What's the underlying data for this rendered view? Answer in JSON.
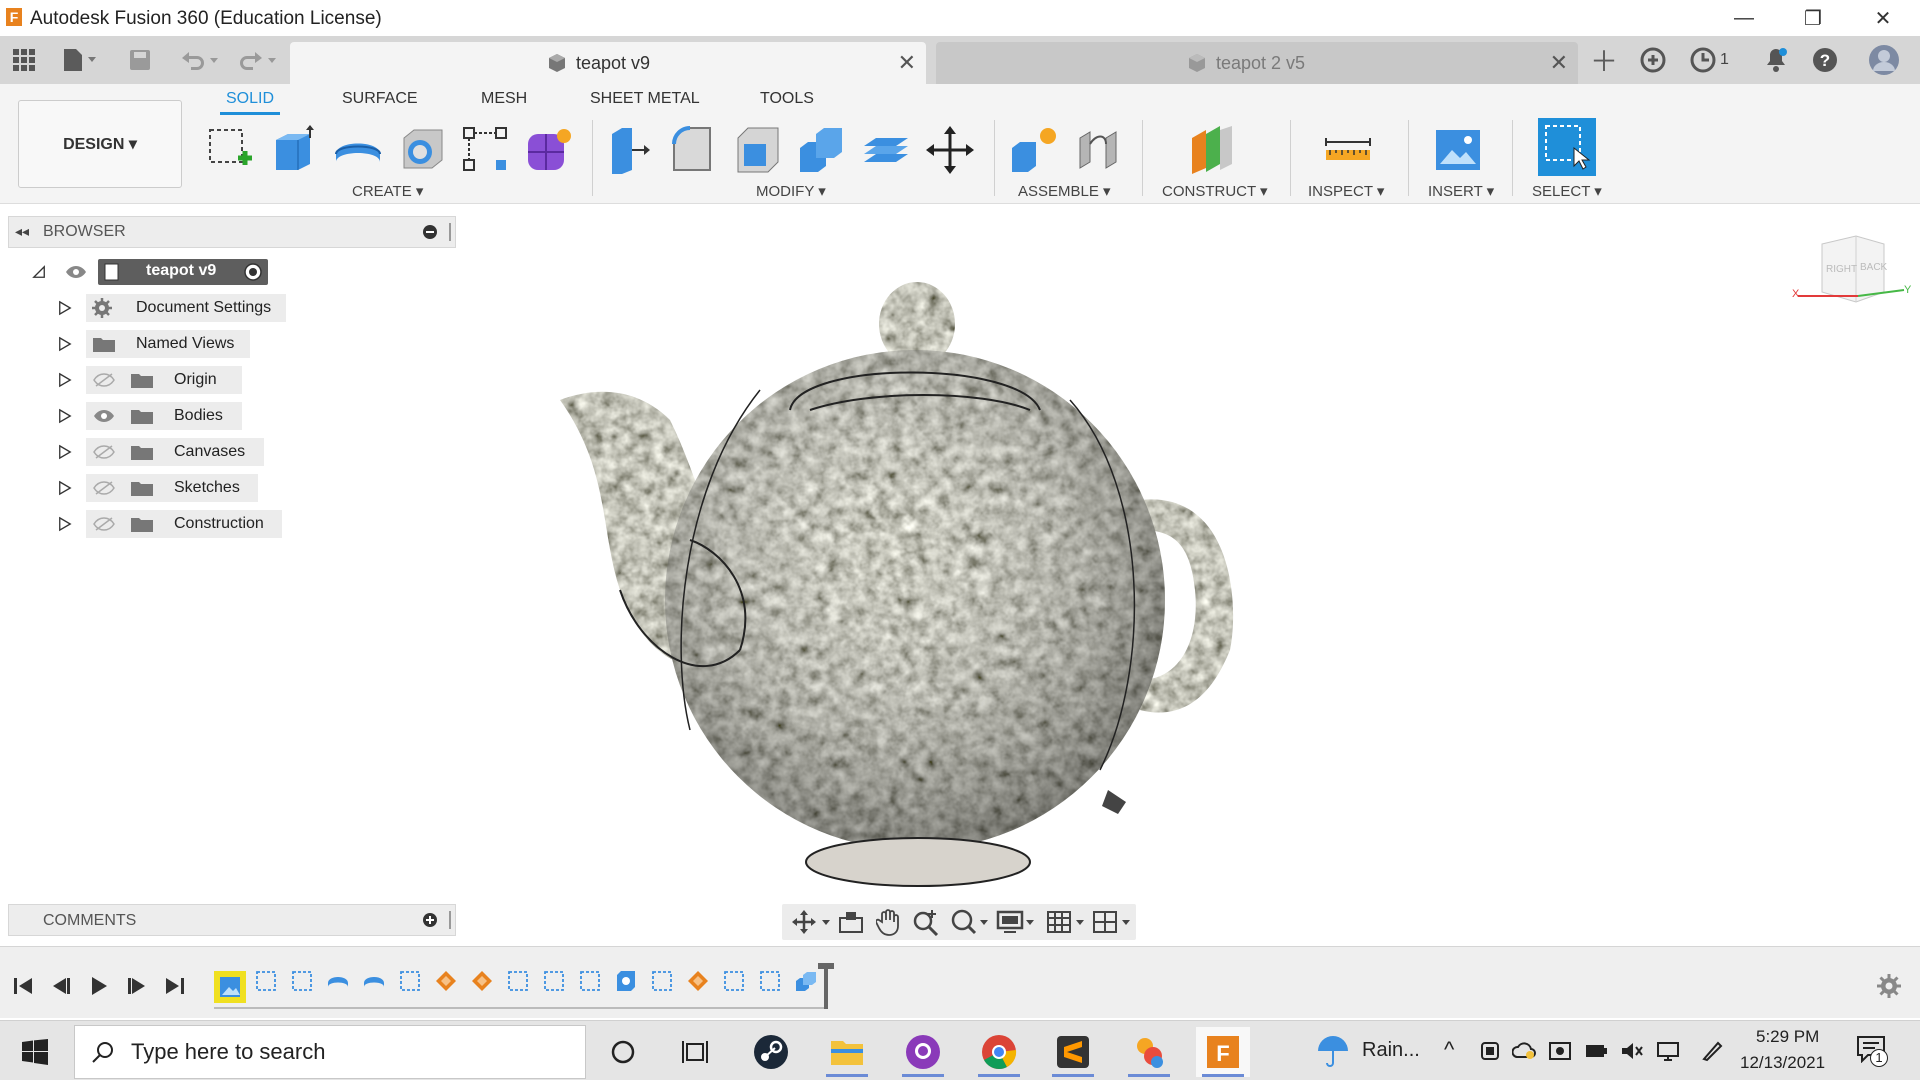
{
  "window": {
    "app_title": "Autodesk Fusion 360 (Education License)",
    "minimize": "—",
    "restore": "❐",
    "close": "✕"
  },
  "tabs": [
    {
      "label": "teapot v9",
      "active": true
    },
    {
      "label": "teapot 2 v5",
      "active": false
    }
  ],
  "tabbar_right": {
    "jobs_count": "1"
  },
  "ribbon": {
    "workspace": "DESIGN ▾",
    "tabs": [
      "SOLID",
      "SURFACE",
      "MESH",
      "SHEET METAL",
      "TOOLS"
    ],
    "groups": [
      "CREATE ▾",
      "MODIFY ▾",
      "ASSEMBLE ▾",
      "CONSTRUCT ▾",
      "INSPECT ▾",
      "INSERT ▾",
      "SELECT ▾"
    ]
  },
  "browser": {
    "title": "BROWSER",
    "root": "teapot v9",
    "items": [
      {
        "label": "Document Settings",
        "icon": "gear-icon"
      },
      {
        "label": "Named Views",
        "icon": "folder-icon"
      },
      {
        "label": "Origin",
        "icon": "folder-icon",
        "visible": false
      },
      {
        "label": "Bodies",
        "icon": "folder-icon",
        "visible": true
      },
      {
        "label": "Canvases",
        "icon": "folder-icon",
        "visible": false
      },
      {
        "label": "Sketches",
        "icon": "folder-icon",
        "visible": false
      },
      {
        "label": "Construction",
        "icon": "folder-icon",
        "visible": false
      }
    ]
  },
  "comments": {
    "title": "COMMENTS"
  },
  "viewcube": {
    "right": "RIGHT",
    "back": "BACK",
    "axis_x": "X",
    "axis_y": "Y"
  },
  "taskbar": {
    "search_placeholder": "Type here to search",
    "weather": "Rain...",
    "time": "5:29 PM",
    "date": "12/13/2021",
    "notification_count": "1"
  },
  "colors": {
    "accent": "#1f8fd9",
    "ribbon_bg": "#f4f4f4",
    "tab_bg": "#d6d6d6"
  }
}
